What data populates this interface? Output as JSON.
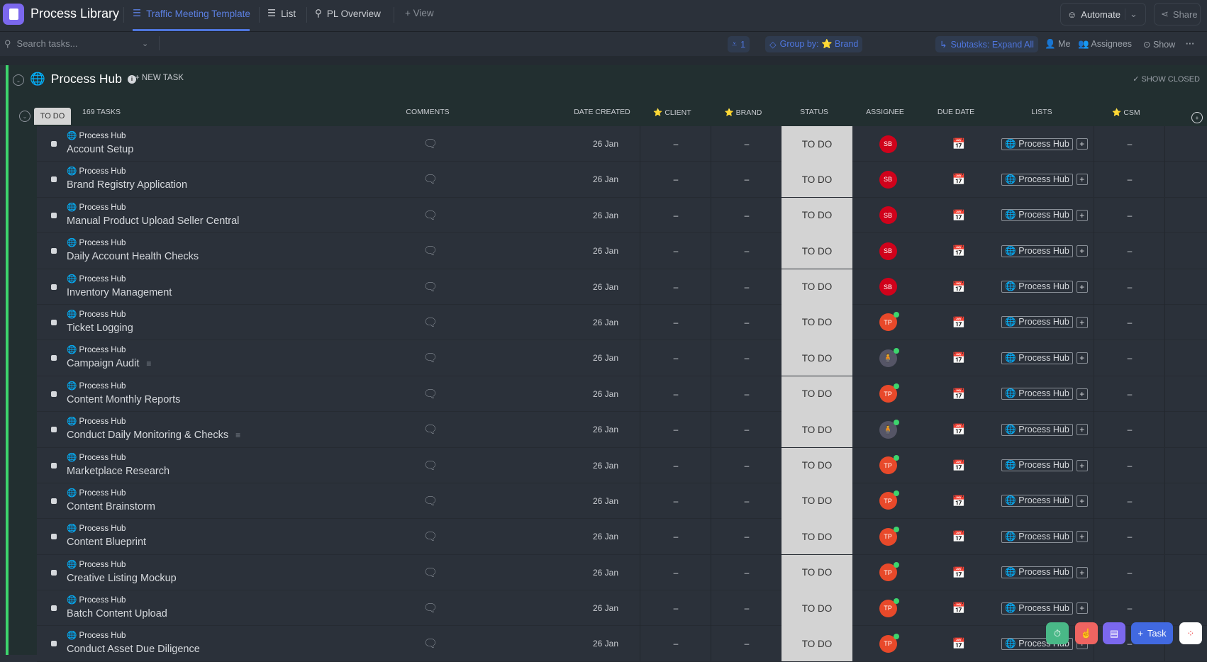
{
  "app": {
    "title": "Process Library"
  },
  "tabs": [
    {
      "label": "Traffic Meeting Template"
    },
    {
      "label": "List"
    },
    {
      "label": "PL Overview"
    },
    {
      "label": "+ View"
    }
  ],
  "header_buttons": {
    "automate": "Automate",
    "share": "Share"
  },
  "toolbar": {
    "search_placeholder": "Search tasks...",
    "filter_count": "1",
    "group_by": "Group by: ⭐ Brand",
    "subtasks": "Subtasks: Expand All",
    "me": "Me",
    "assignees": "Assignees",
    "show": "Show"
  },
  "group": {
    "title": "Process Hub",
    "new_task": "+ NEW TASK",
    "show_closed": "✓ SHOW CLOSED",
    "status": "TO DO",
    "task_count": "169 TASKS"
  },
  "columns": {
    "comments": "COMMENTS",
    "date_created": "DATE CREATED",
    "client": "⭐ CLIENT",
    "brand": "⭐ BRAND",
    "status": "STATUS",
    "assignee": "ASSIGNEE",
    "due_date": "DUE DATE",
    "lists": "LISTS",
    "csm": "⭐ CSM"
  },
  "tasks": [
    {
      "location": "Process Hub",
      "name": "Account Setup",
      "date": "26 Jan",
      "client": "–",
      "brand": "–",
      "status": "TO DO",
      "assignee": "SB",
      "list": "Process Hub",
      "csm": "–",
      "desc": false
    },
    {
      "location": "Process Hub",
      "name": "Brand Registry Application",
      "date": "26 Jan",
      "client": "–",
      "brand": "–",
      "status": "TO DO",
      "assignee": "SB",
      "list": "Process Hub",
      "csm": "–",
      "desc": false
    },
    {
      "location": "Process Hub",
      "name": "Manual Product Upload Seller Central",
      "date": "26 Jan",
      "client": "–",
      "brand": "–",
      "status": "TO DO",
      "assignee": "SB",
      "list": "Process Hub",
      "csm": "–",
      "desc": false
    },
    {
      "location": "Process Hub",
      "name": "Daily Account Health Checks",
      "date": "26 Jan",
      "client": "–",
      "brand": "–",
      "status": "TO DO",
      "assignee": "SB",
      "list": "Process Hub",
      "csm": "–",
      "desc": false
    },
    {
      "location": "Process Hub",
      "name": "Inventory Management",
      "date": "26 Jan",
      "client": "–",
      "brand": "–",
      "status": "TO DO",
      "assignee": "SB",
      "list": "Process Hub",
      "csm": "–",
      "desc": false
    },
    {
      "location": "Process Hub",
      "name": "Ticket Logging",
      "date": "26 Jan",
      "client": "–",
      "brand": "–",
      "status": "TO DO",
      "assignee": "TP",
      "list": "Process Hub",
      "csm": "–",
      "desc": false
    },
    {
      "location": "Process Hub",
      "name": "Campaign Audit",
      "date": "26 Jan",
      "client": "–",
      "brand": "–",
      "status": "TO DO",
      "assignee": "photo",
      "list": "Process Hub",
      "csm": "–",
      "desc": true
    },
    {
      "location": "Process Hub",
      "name": "Content Monthly Reports",
      "date": "26 Jan",
      "client": "–",
      "brand": "–",
      "status": "TO DO",
      "assignee": "TP",
      "list": "Process Hub",
      "csm": "–",
      "desc": false
    },
    {
      "location": "Process Hub",
      "name": "Conduct Daily Monitoring & Checks",
      "date": "26 Jan",
      "client": "–",
      "brand": "–",
      "status": "TO DO",
      "assignee": "photo",
      "list": "Process Hub",
      "csm": "–",
      "desc": true
    },
    {
      "location": "Process Hub",
      "name": "Marketplace Research",
      "date": "26 Jan",
      "client": "–",
      "brand": "–",
      "status": "TO DO",
      "assignee": "TP",
      "list": "Process Hub",
      "csm": "–",
      "desc": false
    },
    {
      "location": "Process Hub",
      "name": "Content Brainstorm",
      "date": "26 Jan",
      "client": "–",
      "brand": "–",
      "status": "TO DO",
      "assignee": "TP",
      "list": "Process Hub",
      "csm": "–",
      "desc": false
    },
    {
      "location": "Process Hub",
      "name": "Content Blueprint",
      "date": "26 Jan",
      "client": "–",
      "brand": "–",
      "status": "TO DO",
      "assignee": "TP",
      "list": "Process Hub",
      "csm": "–",
      "desc": false
    },
    {
      "location": "Process Hub",
      "name": "Creative Listing Mockup",
      "date": "26 Jan",
      "client": "–",
      "brand": "–",
      "status": "TO DO",
      "assignee": "TP",
      "list": "Process Hub",
      "csm": "–",
      "desc": false
    },
    {
      "location": "Process Hub",
      "name": "Batch Content Upload",
      "date": "26 Jan",
      "client": "–",
      "brand": "–",
      "status": "TO DO",
      "assignee": "TP",
      "list": "Process Hub",
      "csm": "–",
      "desc": false
    },
    {
      "location": "Process Hub",
      "name": "Conduct Asset Due Diligence",
      "date": "26 Jan",
      "client": "–",
      "brand": "–",
      "status": "TO DO",
      "assignee": "TP",
      "list": "Process Hub",
      "csm": "–",
      "desc": false
    }
  ],
  "fab": {
    "task_label": "Task"
  },
  "colors": {
    "accent": "#4f76de",
    "group_bar": "#3dd56d",
    "sb": "#d0021b",
    "tp": "#e8492a"
  }
}
